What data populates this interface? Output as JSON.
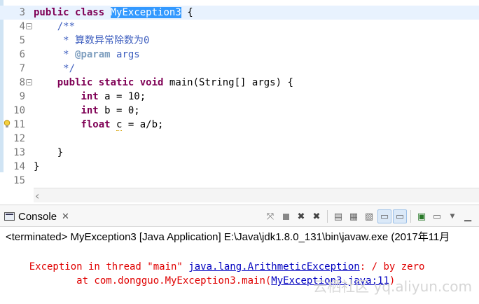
{
  "editor": {
    "lines": [
      {
        "num": "3",
        "fold": false,
        "segments": [
          {
            "t": "public",
            "c": "kw"
          },
          {
            "t": " "
          },
          {
            "t": "class",
            "c": "kw"
          },
          {
            "t": " "
          },
          {
            "t": "MyException3",
            "c": "sel"
          },
          {
            "t": " {"
          }
        ]
      },
      {
        "num": "4",
        "fold": true,
        "segments": [
          {
            "t": "    "
          },
          {
            "t": "/**",
            "c": "cm"
          }
        ]
      },
      {
        "num": "5",
        "fold": false,
        "segments": [
          {
            "t": "     "
          },
          {
            "t": "* 算数异常除数为0",
            "c": "cm"
          }
        ]
      },
      {
        "num": "6",
        "fold": false,
        "segments": [
          {
            "t": "     "
          },
          {
            "t": "* ",
            "c": "cm"
          },
          {
            "t": "@param",
            "c": "tag"
          },
          {
            "t": " args",
            "c": "cm"
          }
        ]
      },
      {
        "num": "7",
        "fold": false,
        "segments": [
          {
            "t": "     "
          },
          {
            "t": "*/",
            "c": "cm"
          }
        ]
      },
      {
        "num": "8",
        "fold": true,
        "segments": [
          {
            "t": "    "
          },
          {
            "t": "public",
            "c": "kw"
          },
          {
            "t": " "
          },
          {
            "t": "static",
            "c": "kw"
          },
          {
            "t": " "
          },
          {
            "t": "void",
            "c": "kw"
          },
          {
            "t": " main(String[] args) {"
          }
        ]
      },
      {
        "num": "9",
        "fold": false,
        "segments": [
          {
            "t": "        "
          },
          {
            "t": "int",
            "c": "kw"
          },
          {
            "t": " a = 10;"
          }
        ]
      },
      {
        "num": "10",
        "fold": false,
        "segments": [
          {
            "t": "        "
          },
          {
            "t": "int",
            "c": "kw"
          },
          {
            "t": " b = 0;"
          }
        ]
      },
      {
        "num": "11",
        "fold": false,
        "warning": true,
        "segments": [
          {
            "t": "        "
          },
          {
            "t": "float",
            "c": "kw"
          },
          {
            "t": " "
          },
          {
            "t": "c",
            "c": "warn-var"
          },
          {
            "t": " = a/b;"
          }
        ]
      },
      {
        "num": "12",
        "fold": false,
        "segments": []
      },
      {
        "num": "13",
        "fold": false,
        "segments": [
          {
            "t": "    }"
          }
        ]
      },
      {
        "num": "14",
        "fold": false,
        "segments": [
          {
            "t": "}"
          }
        ]
      },
      {
        "num": "15",
        "fold": false,
        "segments": []
      }
    ]
  },
  "console": {
    "tab_label": "Console",
    "tab_close": "✕",
    "status": "<terminated> MyException3 [Java Application] E:\\Java\\jdk1.8.0_131\\bin\\javaw.exe (2017年11月",
    "error_line1": {
      "prefix": "Exception in thread \"main\" ",
      "link": "java.lang.ArithmeticException",
      "suffix": ": / by zero"
    },
    "error_line2": {
      "prefix": "        at com.dongguo.MyException3.main(",
      "link": "MyException3.java:11",
      "suffix": ")"
    },
    "toolbar_icons": [
      "pin-icon",
      "stop-icon",
      "remove-launch-icon",
      "remove-all-icon",
      "clear-console-icon",
      "scroll-lock-icon",
      "word-wrap-icon",
      "show-on-stdout-icon",
      "show-on-stderr-icon",
      "pin-console-icon",
      "display-console-icon",
      "view-menu-icon",
      "minimize-icon"
    ]
  },
  "watermark": "云栖社区 yq.aliyun.com",
  "colors": {
    "keyword": "#7f0055",
    "comment": "#3f5fbf",
    "javadoc_tag": "#7f9fbf",
    "selection": "#3399ff",
    "error": "#e00000",
    "link": "#0000c0",
    "active_line": "#e8f2fe"
  }
}
